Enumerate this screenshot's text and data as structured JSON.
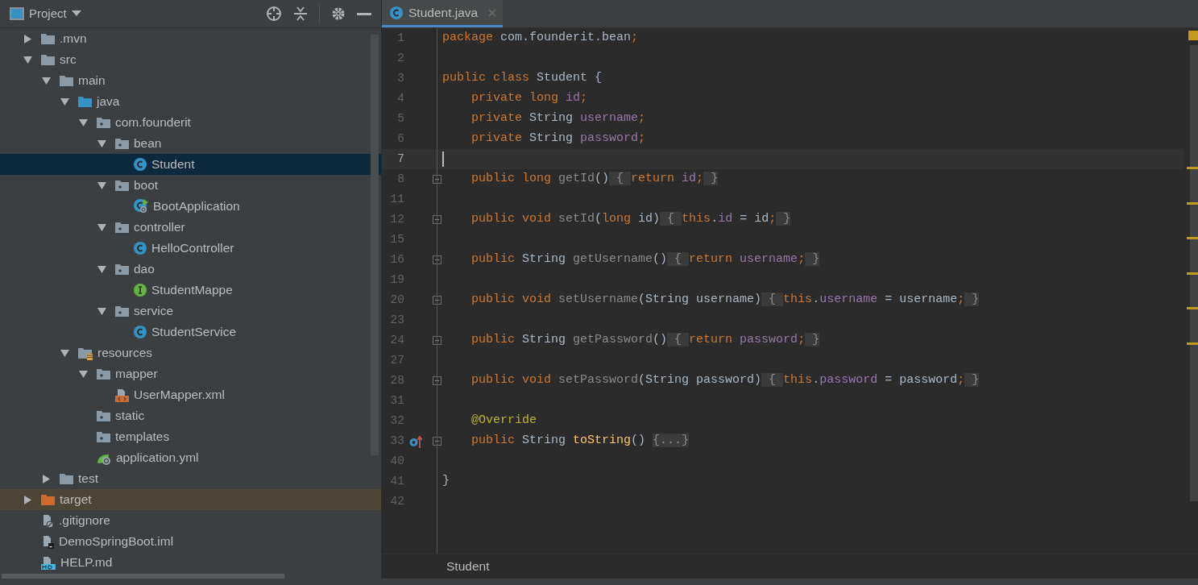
{
  "project_panel": {
    "title": "Project",
    "tree": [
      {
        "label": ".mvn",
        "kind": "folder",
        "expanded": false,
        "selected": false
      },
      {
        "label": "src",
        "kind": "folder",
        "expanded": true,
        "selected": false,
        "children": [
          {
            "label": "main",
            "kind": "folder",
            "expanded": true,
            "selected": false,
            "children": [
              {
                "label": "java",
                "kind": "source-folder",
                "expanded": true,
                "selected": false,
                "children": [
                  {
                    "label": "com.founderit",
                    "kind": "package",
                    "expanded": true,
                    "selected": false,
                    "children": [
                      {
                        "label": "bean",
                        "kind": "package",
                        "expanded": true,
                        "selected": false,
                        "children": [
                          {
                            "label": "Student",
                            "kind": "class",
                            "selected": true
                          }
                        ]
                      },
                      {
                        "label": "boot",
                        "kind": "package",
                        "expanded": true,
                        "selected": false,
                        "children": [
                          {
                            "label": "BootApplication",
                            "kind": "spring-class",
                            "selected": false
                          }
                        ]
                      },
                      {
                        "label": "controller",
                        "kind": "package",
                        "expanded": true,
                        "selected": false,
                        "children": [
                          {
                            "label": "HelloController",
                            "kind": "class",
                            "selected": false
                          }
                        ]
                      },
                      {
                        "label": "dao",
                        "kind": "package",
                        "expanded": true,
                        "selected": false,
                        "children": [
                          {
                            "label": "StudentMappe",
                            "kind": "interface",
                            "selected": false
                          }
                        ]
                      },
                      {
                        "label": "service",
                        "kind": "package",
                        "expanded": true,
                        "selected": false,
                        "children": [
                          {
                            "label": "StudentService",
                            "kind": "class",
                            "selected": false
                          }
                        ]
                      }
                    ]
                  }
                ]
              },
              {
                "label": "resources",
                "kind": "resources-folder",
                "expanded": true,
                "selected": false,
                "children": [
                  {
                    "label": "mapper",
                    "kind": "package",
                    "expanded": true,
                    "selected": false,
                    "children": [
                      {
                        "label": "UserMapper.xml",
                        "kind": "xml-file",
                        "selected": false
                      }
                    ]
                  },
                  {
                    "label": "static",
                    "kind": "package",
                    "selected": false
                  },
                  {
                    "label": "templates",
                    "kind": "package",
                    "selected": false
                  },
                  {
                    "label": "application.yml",
                    "kind": "spring-config",
                    "selected": false
                  }
                ]
              }
            ]
          },
          {
            "label": "test",
            "kind": "folder",
            "expanded": false,
            "selected": false
          }
        ]
      },
      {
        "label": "target",
        "kind": "excluded-folder",
        "expanded": false,
        "selected": false
      },
      {
        "label": ".gitignore",
        "kind": "ignore-file",
        "selected": false
      },
      {
        "label": "DemoSpringBoot.iml",
        "kind": "module-file",
        "selected": false
      },
      {
        "label": "HELP.md",
        "kind": "markdown-file",
        "selected": false
      }
    ]
  },
  "editor": {
    "tabs": [
      {
        "label": "Student.java",
        "selected": true
      }
    ],
    "lines": [
      {
        "number": "1",
        "kind": "top",
        "current": false,
        "foldable": false,
        "tokens": [
          {
            "kind": "keyword",
            "text": "package"
          },
          {
            "kind": "plain",
            "text": " com.founderit.bean"
          },
          {
            "kind": "keyword",
            "text": ";"
          }
        ]
      },
      {
        "number": "2",
        "kind": "blank",
        "current": false,
        "foldable": false
      },
      {
        "number": "3",
        "kind": "top",
        "current": false,
        "foldable": false,
        "tokens": [
          {
            "kind": "keyword",
            "text": "public class "
          },
          {
            "kind": "plain",
            "text": "Student {"
          }
        ]
      },
      {
        "number": "4",
        "kind": "member",
        "current": false,
        "foldable": false,
        "tokens": [
          {
            "kind": "keyword",
            "text": "private long "
          },
          {
            "kind": "field",
            "text": "id"
          },
          {
            "kind": "keyword",
            "text": ";"
          }
        ]
      },
      {
        "number": "5",
        "kind": "member",
        "current": false,
        "foldable": false,
        "tokens": [
          {
            "kind": "keyword",
            "text": "private "
          },
          {
            "kind": "plain",
            "text": "String "
          },
          {
            "kind": "field",
            "text": "username"
          },
          {
            "kind": "keyword",
            "text": ";"
          }
        ]
      },
      {
        "number": "6",
        "kind": "member",
        "current": false,
        "foldable": false,
        "tokens": [
          {
            "kind": "keyword",
            "text": "private "
          },
          {
            "kind": "plain",
            "text": "String "
          },
          {
            "kind": "field",
            "text": "password"
          },
          {
            "kind": "keyword",
            "text": ";"
          }
        ]
      },
      {
        "number": "7",
        "kind": "blank",
        "current": true,
        "foldable": false
      },
      {
        "number": "8",
        "kind": "member",
        "current": false,
        "foldable": true,
        "tokens": [
          {
            "kind": "keyword",
            "text": "public long "
          },
          {
            "kind": "unused",
            "text": "getId"
          },
          {
            "kind": "plain",
            "text": "()"
          },
          {
            "kind": "fold",
            "text": " { "
          },
          {
            "kind": "keyword",
            "text": "return "
          },
          {
            "kind": "field",
            "text": "id"
          },
          {
            "kind": "keyword",
            "text": ";"
          },
          {
            "kind": "fold",
            "text": " }"
          }
        ]
      },
      {
        "number": "11",
        "kind": "blank",
        "current": false,
        "foldable": false
      },
      {
        "number": "12",
        "kind": "member",
        "current": false,
        "foldable": true,
        "tokens": [
          {
            "kind": "keyword",
            "text": "public void "
          },
          {
            "kind": "unused",
            "text": "setId"
          },
          {
            "kind": "plain",
            "text": "("
          },
          {
            "kind": "keyword",
            "text": "long "
          },
          {
            "kind": "plain",
            "text": "id)"
          },
          {
            "kind": "fold",
            "text": " { "
          },
          {
            "kind": "keyword",
            "text": "this"
          },
          {
            "kind": "plain",
            "text": "."
          },
          {
            "kind": "field",
            "text": "id"
          },
          {
            "kind": "plain",
            "text": " = id"
          },
          {
            "kind": "keyword",
            "text": ";"
          },
          {
            "kind": "fold",
            "text": " }"
          }
        ]
      },
      {
        "number": "15",
        "kind": "blank",
        "current": false,
        "foldable": false
      },
      {
        "number": "16",
        "kind": "member",
        "current": false,
        "foldable": true,
        "tokens": [
          {
            "kind": "keyword",
            "text": "public "
          },
          {
            "kind": "plain",
            "text": "String "
          },
          {
            "kind": "unused",
            "text": "getUsername"
          },
          {
            "kind": "plain",
            "text": "()"
          },
          {
            "kind": "fold",
            "text": " { "
          },
          {
            "kind": "keyword",
            "text": "return "
          },
          {
            "kind": "field",
            "text": "username"
          },
          {
            "kind": "keyword",
            "text": ";"
          },
          {
            "kind": "fold",
            "text": " }"
          }
        ]
      },
      {
        "number": "19",
        "kind": "blank",
        "current": false,
        "foldable": false
      },
      {
        "number": "20",
        "kind": "member",
        "current": false,
        "foldable": true,
        "tokens": [
          {
            "kind": "keyword",
            "text": "public void "
          },
          {
            "kind": "unused",
            "text": "setUsername"
          },
          {
            "kind": "plain",
            "text": "(String username)"
          },
          {
            "kind": "fold",
            "text": " { "
          },
          {
            "kind": "keyword",
            "text": "this"
          },
          {
            "kind": "plain",
            "text": "."
          },
          {
            "kind": "field",
            "text": "username"
          },
          {
            "kind": "plain",
            "text": " = username"
          },
          {
            "kind": "keyword",
            "text": ";"
          },
          {
            "kind": "fold",
            "text": " }"
          }
        ]
      },
      {
        "number": "23",
        "kind": "blank",
        "current": false,
        "foldable": false
      },
      {
        "number": "24",
        "kind": "member",
        "current": false,
        "foldable": true,
        "tokens": [
          {
            "kind": "keyword",
            "text": "public "
          },
          {
            "kind": "plain",
            "text": "String "
          },
          {
            "kind": "unused",
            "text": "getPassword"
          },
          {
            "kind": "plain",
            "text": "()"
          },
          {
            "kind": "fold",
            "text": " { "
          },
          {
            "kind": "keyword",
            "text": "return "
          },
          {
            "kind": "field",
            "text": "password"
          },
          {
            "kind": "keyword",
            "text": ";"
          },
          {
            "kind": "fold",
            "text": " }"
          }
        ]
      },
      {
        "number": "27",
        "kind": "blank",
        "current": false,
        "foldable": false
      },
      {
        "number": "28",
        "kind": "member",
        "current": false,
        "foldable": true,
        "tokens": [
          {
            "kind": "keyword",
            "text": "public void "
          },
          {
            "kind": "unused",
            "text": "setPassword"
          },
          {
            "kind": "plain",
            "text": "(String password)"
          },
          {
            "kind": "fold",
            "text": " { "
          },
          {
            "kind": "keyword",
            "text": "this"
          },
          {
            "kind": "plain",
            "text": "."
          },
          {
            "kind": "field",
            "text": "password"
          },
          {
            "kind": "plain",
            "text": " = password"
          },
          {
            "kind": "keyword",
            "text": ";"
          },
          {
            "kind": "fold",
            "text": " }"
          }
        ]
      },
      {
        "number": "31",
        "kind": "blank",
        "current": false,
        "foldable": false
      },
      {
        "number": "32",
        "kind": "member",
        "current": false,
        "foldable": false,
        "tokens": [
          {
            "kind": "annotation",
            "text": "@Override"
          }
        ]
      },
      {
        "number": "33",
        "kind": "override",
        "current": false,
        "foldable": true,
        "tokens": [
          {
            "kind": "keyword",
            "text": "public "
          },
          {
            "kind": "plain",
            "text": "String "
          },
          {
            "kind": "method",
            "text": "toString"
          },
          {
            "kind": "plain",
            "text": "() "
          },
          {
            "kind": "fold",
            "text": "{...}"
          }
        ]
      },
      {
        "number": "40",
        "kind": "blank",
        "current": false,
        "foldable": false
      },
      {
        "number": "41",
        "kind": "top",
        "current": false,
        "foldable": false,
        "tokens": [
          {
            "kind": "plain",
            "text": "}"
          }
        ]
      },
      {
        "number": "42",
        "kind": "blank",
        "current": false,
        "foldable": false
      }
    ],
    "breadcrumb": "Student"
  }
}
